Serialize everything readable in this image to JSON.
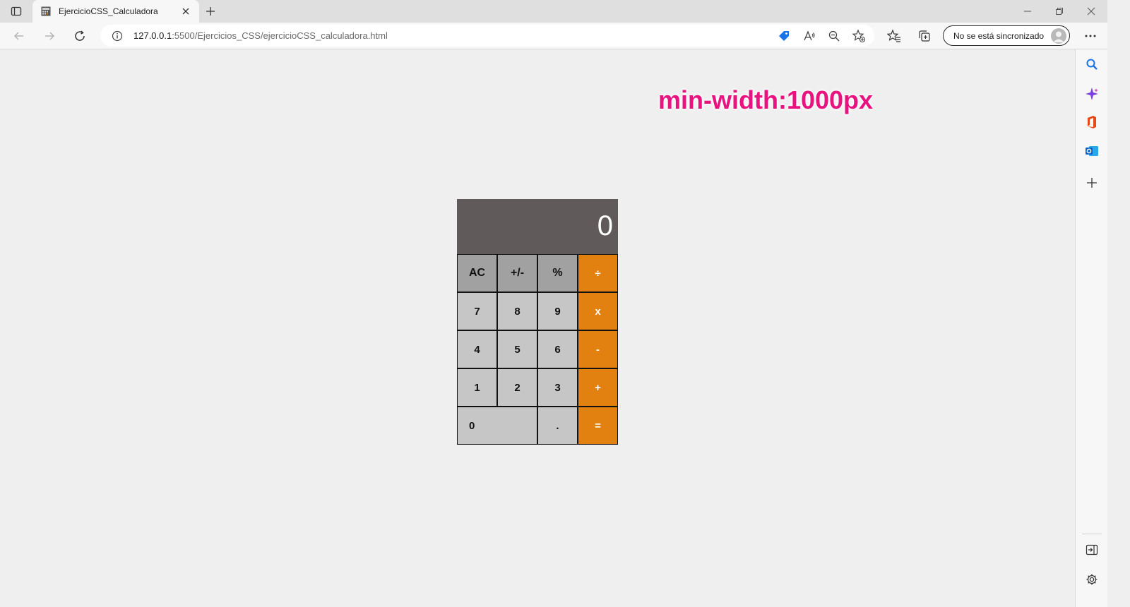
{
  "browser": {
    "tab": {
      "title": "EjercicioCSS_Calculadora",
      "favicon": "calculator-favicon"
    },
    "address_bar": {
      "url_host": "127.0.0.1",
      "url_rest": ":5500/Ejercicios_CSS/ejercicioCSS_calculadora.html"
    },
    "sync_button": {
      "label": "No se está sincronizado"
    },
    "toolbar_icons": [
      "back-icon",
      "forward-icon",
      "refresh-icon",
      "site-info-icon",
      "shopping-tag-icon",
      "read-aloud-icon",
      "zoom-out-icon",
      "add-favorite-icon",
      "favorites-icon",
      "collections-icon",
      "more-icon"
    ],
    "sidebar_icons": [
      "search-icon",
      "copilot-icon",
      "office-icon",
      "outlook-icon",
      "add-icon",
      "hide-sidebar-icon",
      "settings-icon"
    ]
  },
  "page": {
    "media_label": "min-width:1000px",
    "calculator": {
      "display": "0",
      "rows": [
        [
          {
            "label": "AC",
            "kind": "fn"
          },
          {
            "label": "+/-",
            "kind": "fn"
          },
          {
            "label": "%",
            "kind": "fn"
          },
          {
            "label": "÷",
            "kind": "op"
          }
        ],
        [
          {
            "label": "7",
            "kind": "num"
          },
          {
            "label": "8",
            "kind": "num"
          },
          {
            "label": "9",
            "kind": "num"
          },
          {
            "label": "x",
            "kind": "op"
          }
        ],
        [
          {
            "label": "4",
            "kind": "num"
          },
          {
            "label": "5",
            "kind": "num"
          },
          {
            "label": "6",
            "kind": "num"
          },
          {
            "label": "-",
            "kind": "op"
          }
        ],
        [
          {
            "label": "1",
            "kind": "num"
          },
          {
            "label": "2",
            "kind": "num"
          },
          {
            "label": "3",
            "kind": "num"
          },
          {
            "label": "+",
            "kind": "op"
          }
        ],
        [
          {
            "label": "0",
            "kind": "zero"
          },
          {
            "label": ".",
            "kind": "num"
          },
          {
            "label": "=",
            "kind": "op"
          }
        ]
      ]
    }
  },
  "colors": {
    "accent_pink": "#e8137f",
    "operator_orange": "#e2810f",
    "function_gray": "#a1a1a1",
    "number_gray": "#c6c6c6",
    "display_bg": "#615a5a"
  }
}
